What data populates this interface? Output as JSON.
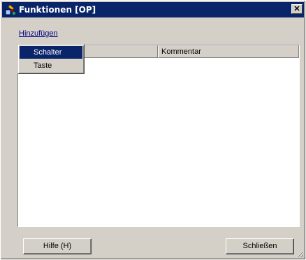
{
  "window": {
    "title": "Funktionen [OP]",
    "close_glyph": "✕",
    "app_icon": "tools-icon"
  },
  "menu": {
    "add_label": "Hinzufügen"
  },
  "dropdown": {
    "items": [
      {
        "label": "Schalter",
        "selected": true
      },
      {
        "label": "Taste",
        "selected": false
      }
    ]
  },
  "list": {
    "columns": [
      "",
      "Kommentar"
    ],
    "rows": []
  },
  "buttons": {
    "help_label": "Hilfe (H)",
    "close_label": "Schließen"
  },
  "colors": {
    "titlebar": "#0a246a",
    "face": "#d4d0c8",
    "selection": "#0a246a",
    "link": "#000080"
  }
}
